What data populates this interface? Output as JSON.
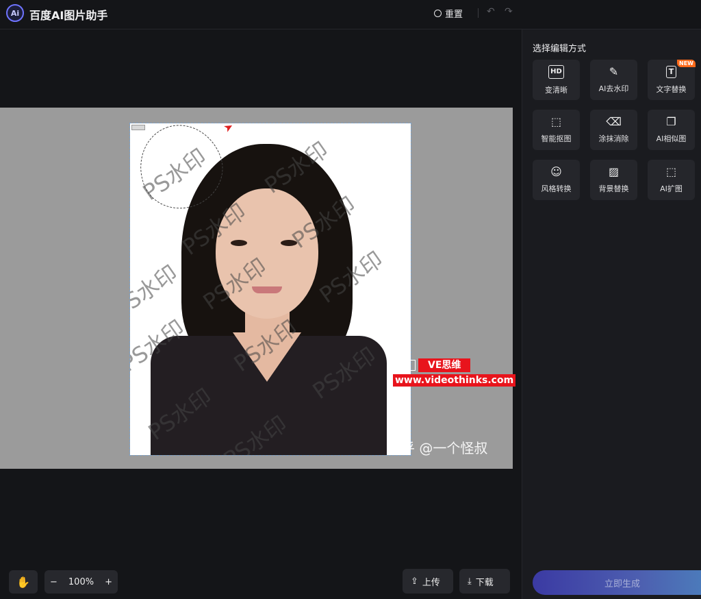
{
  "header": {
    "logo_text": "Ai",
    "app_title": "百度AI图片助手",
    "reset_label": "重置",
    "undo_icon": "undo-icon",
    "redo_icon": "redo-icon"
  },
  "canvas": {
    "watermark_text": "PS水印",
    "ve_badge_label": "VE思维",
    "ve_url": "www.videothinks.com",
    "credit_text": "知乎 @一个怪叔"
  },
  "bottom_toolbar": {
    "zoom_level": "100%",
    "zoom_out_symbol": "−",
    "zoom_in_symbol": "+",
    "upload_label": "上传",
    "download_label": "下载"
  },
  "panel": {
    "title": "选择编辑方式",
    "tools": [
      {
        "label": "变清晰",
        "icon": "hd-icon",
        "glyph": "HD"
      },
      {
        "label": "AI去水印",
        "icon": "magic-wand-icon",
        "glyph": "✎"
      },
      {
        "label": "文字替换",
        "icon": "text-replace-icon",
        "glyph": "T",
        "badge": "NEW"
      },
      {
        "label": "智能抠图",
        "icon": "cutout-icon",
        "glyph": "⬚"
      },
      {
        "label": "涂抹消除",
        "icon": "eraser-icon",
        "glyph": "⌫"
      },
      {
        "label": "AI相似图",
        "icon": "similar-image-icon",
        "glyph": "❐"
      },
      {
        "label": "风格转换",
        "icon": "style-icon",
        "glyph": "☺"
      },
      {
        "label": "背景替换",
        "icon": "background-icon",
        "glyph": "▨"
      },
      {
        "label": "AI扩图",
        "icon": "expand-icon",
        "glyph": "⬚"
      }
    ],
    "generate_label": "立即生成"
  },
  "colors": {
    "accent": "#4d5fb0",
    "badge_red": "#e8141c",
    "new_badge": "#ff6a1a"
  }
}
